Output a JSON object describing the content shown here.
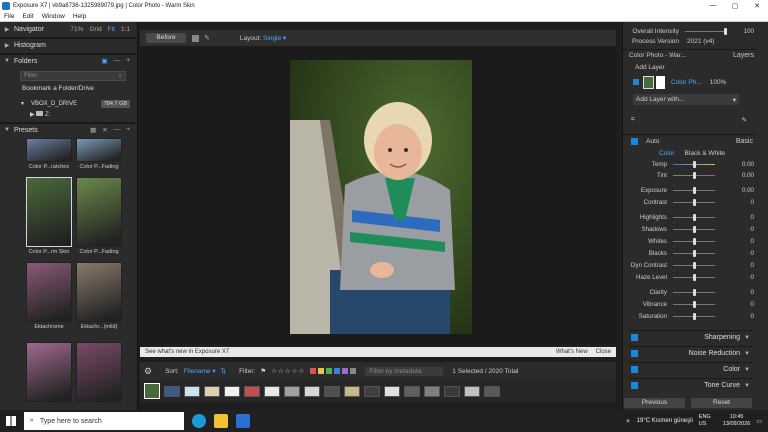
{
  "title_bar": {
    "title": "Exposure X7 | vb9a8736-1325989079.jpg | Color Photo - Warm Skin",
    "minimize": "—",
    "maximize": "▢",
    "close": "✕"
  },
  "menu": [
    "File",
    "Edit",
    "Window",
    "Help"
  ],
  "left_panel": {
    "navigator": {
      "label": "Navigator",
      "zoom": "71%",
      "grid": "Grid",
      "fit": "Fit",
      "one": "1:1"
    },
    "histogram": {
      "label": "Histogram"
    },
    "folders": {
      "label": "Folders",
      "filter_placeholder": "Filter",
      "bookmark": "Bookmark a Folder/Drive",
      "drive": "VBOX_D_DRIVE",
      "drive_size": "784.7 GB",
      "sub": "Z:"
    },
    "presets": {
      "label": "Presets",
      "items": [
        {
          "label": "Color P...ratches",
          "tint": "#6a7fa0"
        },
        {
          "label": "Color P...Fading",
          "tint": "#7a9ab8"
        },
        {
          "label": "Color P...rm Skin",
          "tint": "#4a6a3a"
        },
        {
          "label": "Color P...Fading",
          "tint": "#6a8a4a"
        },
        {
          "label": "Ektachrome",
          "tint": "#8a5a7a"
        },
        {
          "label": "Ektachr...(mild)",
          "tint": "#8a7a6a"
        },
        {
          "label": "",
          "tint": "#a06a90"
        },
        {
          "label": "",
          "tint": "#7a4a6a"
        }
      ]
    }
  },
  "toolbar": {
    "before": "Before",
    "layout_label": "Layout:",
    "layout_value": "Single ▾"
  },
  "news_bar": {
    "text": "See what's new in Exposure X7",
    "whats_new": "What's New",
    "close": "Close"
  },
  "filter_bar": {
    "sort_label": "Sort:",
    "sort_value": "Filename ▾",
    "filter_label": "Filter:",
    "search_placeholder": "Filter by metadata",
    "selected": "1 Selected / 2020 Total"
  },
  "right_panel": {
    "overall_intensity": {
      "label": "Overall Intensity",
      "value": "100"
    },
    "process_version": {
      "label": "Process Version",
      "value": "2021 (v4)"
    },
    "preset_name": "Color Photo - War...",
    "layers_label": "Layers",
    "add_layer": "Add Layer",
    "layer_item": {
      "name": "Color Ph...",
      "opacity": "100%"
    },
    "add_layer_with": "Add Layer with...",
    "basic": {
      "auto": "Auto",
      "label": "Basic",
      "mode_color": "Color",
      "mode_bw": "Black & White"
    },
    "sliders": [
      {
        "label": "Temp",
        "value": "0.00",
        "pos": 0.5
      },
      {
        "label": "Tint",
        "value": "0.00",
        "pos": 0.5
      },
      {
        "label": "Exposure",
        "value": "0.00",
        "pos": 0.5
      },
      {
        "label": "Contrast",
        "value": "0",
        "pos": 0.5
      },
      {
        "label": "Highlights",
        "value": "0",
        "pos": 0.5
      },
      {
        "label": "Shadows",
        "value": "0",
        "pos": 0.5
      },
      {
        "label": "Whites",
        "value": "0",
        "pos": 0.5
      },
      {
        "label": "Blacks",
        "value": "0",
        "pos": 0.5
      },
      {
        "label": "Dyn Contrast",
        "value": "0",
        "pos": 0.5
      },
      {
        "label": "Haze Level",
        "value": "0",
        "pos": 0.5
      },
      {
        "label": "Clarity",
        "value": "0",
        "pos": 0.5
      },
      {
        "label": "Vibrance",
        "value": "0",
        "pos": 0.5
      },
      {
        "label": "Saturation",
        "value": "0",
        "pos": 0.5
      }
    ],
    "sections": [
      "Sharpening",
      "Noise Reduction",
      "Color",
      "Tone Curve"
    ],
    "previous": "Previous",
    "reset": "Reset"
  },
  "taskbar": {
    "search": "Type here to search",
    "weather": "19°C Kısmen güneşli",
    "lang": "ENG US",
    "time": "10:45",
    "date": "13/09/2026"
  }
}
